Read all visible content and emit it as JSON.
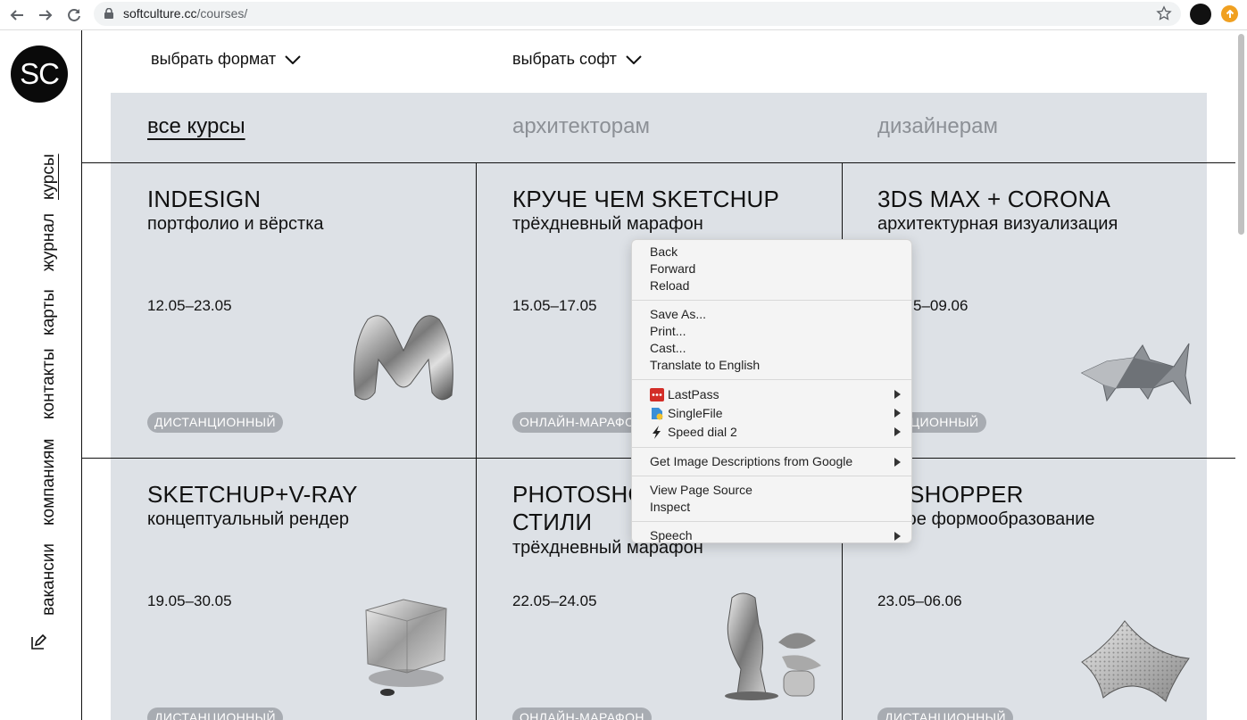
{
  "browser": {
    "url_host": "softculture.cc",
    "url_path": "/courses/"
  },
  "site": {
    "logo_text": "SC",
    "nav": [
      "курсы",
      "журнал",
      "карты",
      "контакты",
      "компаниям",
      "вакансии"
    ],
    "filters": {
      "format": "выбрать формат",
      "software": "выбрать софт"
    },
    "tabs": [
      "все курсы",
      "архитекторам",
      "дизайнерам"
    ]
  },
  "courses": [
    {
      "title": "INDESIGN",
      "subtitle": "портфолио и вёрстка",
      "date": "12.05–23.05",
      "badge": "ДИСТАНЦИОННЫЙ"
    },
    {
      "title": "КРУЧЕ ЧЕМ SKETCHUP",
      "subtitle": "трёхдневный марафон",
      "date": "15.05–17.05",
      "badge": "ОНЛАЙН-МАРАФОН"
    },
    {
      "title": "3DS MAX + CORONA",
      "subtitle": "архитектурная визуализация",
      "date": "5–09.06",
      "badge": "ТАНЦИОННЫЙ"
    },
    {
      "title": "SKETCHUP+V-RAY",
      "subtitle": "концептуальный рендер",
      "date": "19.05–30.05",
      "badge": "ДИСТАНЦИОННЫЙ"
    },
    {
      "title_line1": "PHOTOSHO",
      "title_line2": "СТИЛИ",
      "subtitle": "трёхдневный марафон",
      "date": "22.05–24.05",
      "badge": "ОНЛАЙН-МАРАФОН"
    },
    {
      "title": "ASSHOPPER",
      "subtitle": "ровое формообразование",
      "date": "23.05–06.06",
      "badge": "ДИСТАНЦИОННЫЙ"
    }
  ],
  "context_menu": {
    "group1": [
      "Back",
      "Forward",
      "Reload"
    ],
    "group2": [
      "Save As...",
      "Print...",
      "Cast...",
      "Translate to English"
    ],
    "extensions": [
      {
        "label": "LastPass",
        "icon": "lastpass-icon"
      },
      {
        "label": "SingleFile",
        "icon": "singlefile-icon"
      },
      {
        "label": "Speed dial 2",
        "icon": "speed-dial-icon"
      }
    ],
    "image_desc": "Get Image Descriptions from Google",
    "group5": [
      "View Page Source",
      "Inspect"
    ],
    "speech": "Speech"
  },
  "colors": {
    "card_bg": "#dde1e6",
    "badge_bg": "#a8acb2",
    "text": "#111111",
    "muted_tab": "#8c9096"
  }
}
